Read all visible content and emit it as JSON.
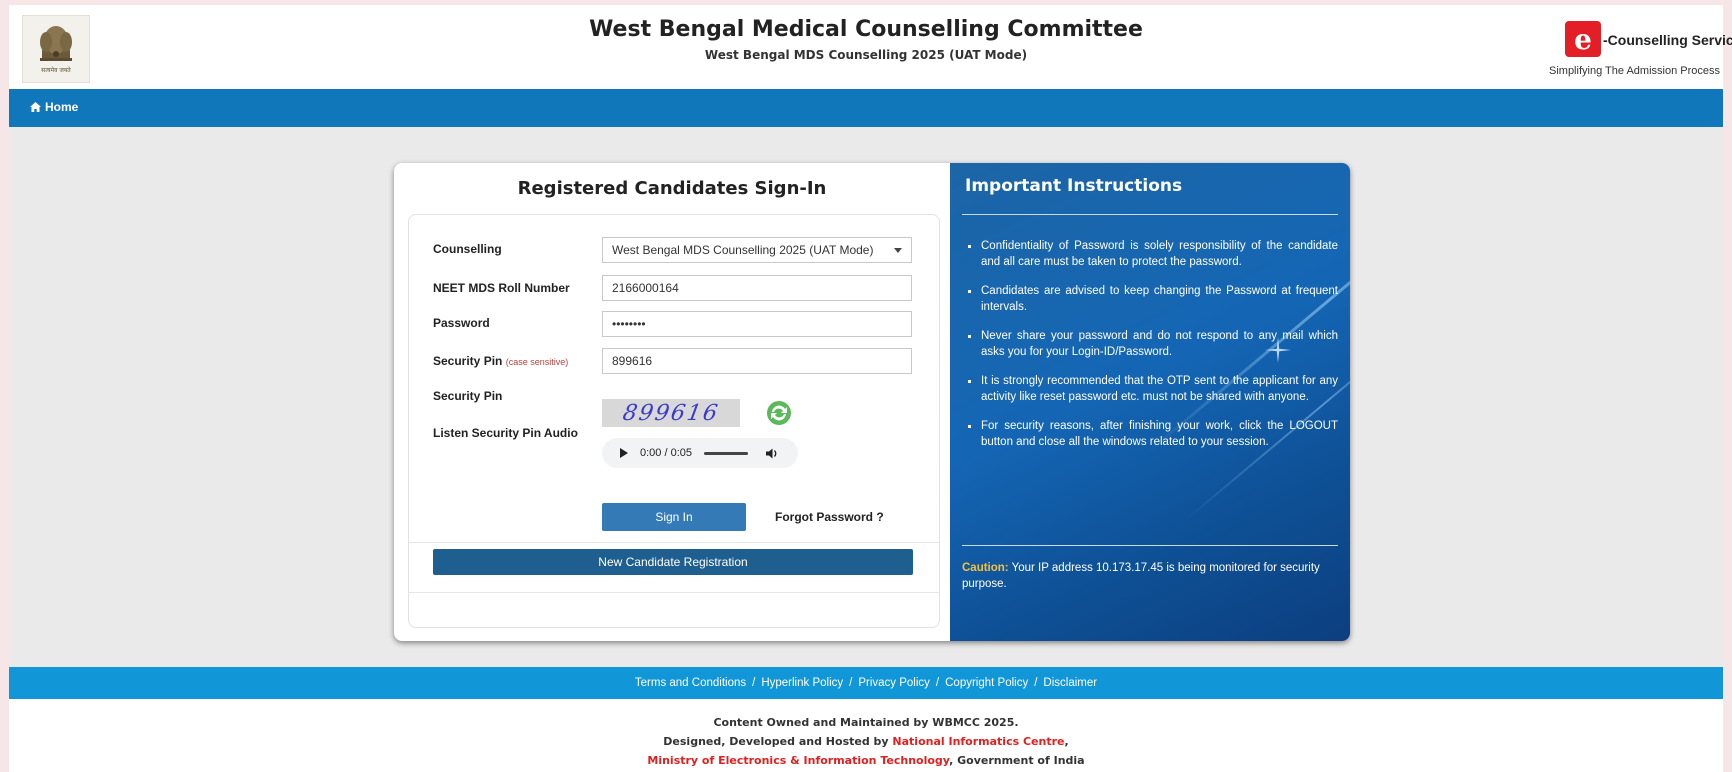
{
  "header": {
    "title": "West Bengal Medical Counselling Committee",
    "subtitle": "West Bengal MDS Counselling 2025 (UAT Mode)",
    "emblem_caption": "सत्यमेव जयते",
    "brand": {
      "logo_letter": "e",
      "name": "-Counselling Services",
      "tagline": "Simplifying The Admission Process",
      "color": "#e41e26"
    }
  },
  "nav": {
    "home_label": "Home",
    "bar_color": "#1177bb"
  },
  "signin": {
    "title": "Registered Candidates Sign-In",
    "fields": {
      "counselling": {
        "label": "Counselling",
        "value": "West Bengal MDS Counselling 2025 (UAT Mode)"
      },
      "roll": {
        "label": "NEET MDS Roll Number",
        "value": "2166000164"
      },
      "password": {
        "label": "Password",
        "value": "••••••••"
      },
      "security_pin_input": {
        "label": "Security Pin",
        "hint": "(case sensitive)",
        "value": "899616"
      },
      "security_pin_image": {
        "label": "Security Pin",
        "captcha_text": "899616"
      },
      "audio": {
        "label": "Listen Security Pin Audio",
        "time": "0:00 / 0:05"
      }
    },
    "signin_button": "Sign In",
    "forgot_link": "Forgot Password ?",
    "register_button": "New Candidate Registration"
  },
  "instructions": {
    "title": "Important Instructions",
    "items": [
      "Confidentiality of Password is solely responsibility of the candidate and all care must be taken to protect the password.",
      "Candidates are advised to keep changing the Password at frequent intervals.",
      "Never share your password and do not respond to any mail which asks you for your Login-ID/Password.",
      "It is strongly recommended that the OTP sent to the applicant for any activity like reset password etc. must not be shared with anyone.",
      "For security reasons, after finishing your work, click the LOGOUT button and close all the windows related to your session."
    ],
    "caution_label": "Caution:",
    "caution_text": " Your IP address 10.173.17.45 is being monitored for security purpose."
  },
  "footer": {
    "links": [
      "Terms and Conditions",
      "Hyperlink Policy",
      "Privacy Policy",
      "Copyright Policy",
      "Disclaimer"
    ],
    "line1": "Content Owned and Maintained by WBMCC 2025.",
    "line2_prefix": "Designed, Developed and Hosted by ",
    "line2_org": "National Informatics Centre",
    "line2_suffix": ",",
    "line3_org": "Ministry of Electronics & Information Technology",
    "line3_suffix": ", Government of India",
    "bar_color": "#1196d8"
  }
}
